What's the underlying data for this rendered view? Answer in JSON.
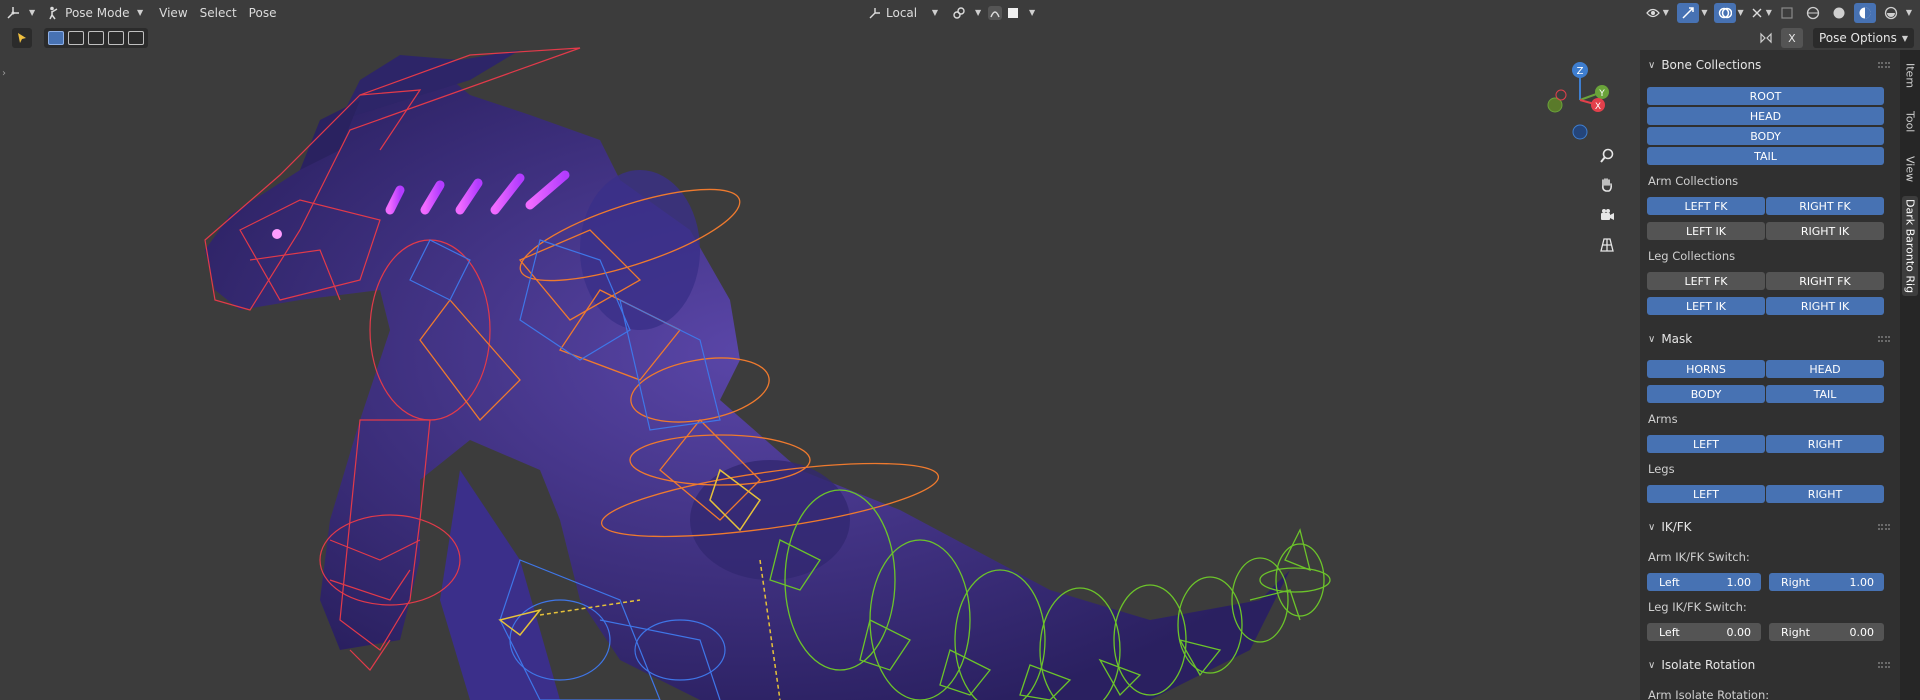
{
  "header": {
    "mode": "Pose Mode",
    "menus": [
      "View",
      "Select",
      "Pose"
    ],
    "transform_orientation": "Local",
    "pose_options": "Pose Options",
    "x_mirror": "X"
  },
  "icons": {
    "editor_type": "axes-icon",
    "mode": "pose-icon",
    "orientation": "orientation-icon",
    "snap": "link-icon",
    "proportional": "proportional-icon"
  },
  "gizmo": {
    "z": "Z",
    "y": "Y",
    "x": "X"
  },
  "tabs": [
    "Item",
    "Tool",
    "View",
    "Dark Baronto Rig"
  ],
  "sidebar": {
    "bone_collections": {
      "title": "Bone Collections",
      "main": [
        "ROOT",
        "HEAD",
        "BODY",
        "TAIL"
      ],
      "arm_label": "Arm Collections",
      "arm": [
        [
          "LEFT FK",
          "RIGHT FK"
        ],
        [
          "LEFT IK",
          "RIGHT IK"
        ]
      ],
      "leg_label": "Leg Collections",
      "leg": [
        [
          "LEFT FK",
          "RIGHT FK"
        ],
        [
          "LEFT IK",
          "RIGHT IK"
        ]
      ]
    },
    "mask": {
      "title": "Mask",
      "row1": [
        "HORNS",
        "HEAD"
      ],
      "row2": [
        "BODY",
        "TAIL"
      ],
      "arms_label": "Arms",
      "arms": [
        "LEFT",
        "RIGHT"
      ],
      "legs_label": "Legs",
      "legs": [
        "LEFT",
        "RIGHT"
      ]
    },
    "ikfk": {
      "title": "IK/FK",
      "arm_label": "Arm IK/FK Switch:",
      "arm_left": "Left",
      "arm_left_val": "1.00",
      "arm_right": "Right",
      "arm_right_val": "1.00",
      "leg_label": "Leg IK/FK Switch:",
      "leg_left": "Left",
      "leg_left_val": "0.00",
      "leg_right": "Right",
      "leg_right_val": "0.00"
    },
    "isolate": {
      "title": "Isolate Rotation",
      "arm_label": "Arm Isolate Rotation:"
    }
  },
  "colors": {
    "accent": "#4772b3",
    "button_off": "#545454",
    "panel": "#303030",
    "viewport": "#3c3c3c"
  }
}
